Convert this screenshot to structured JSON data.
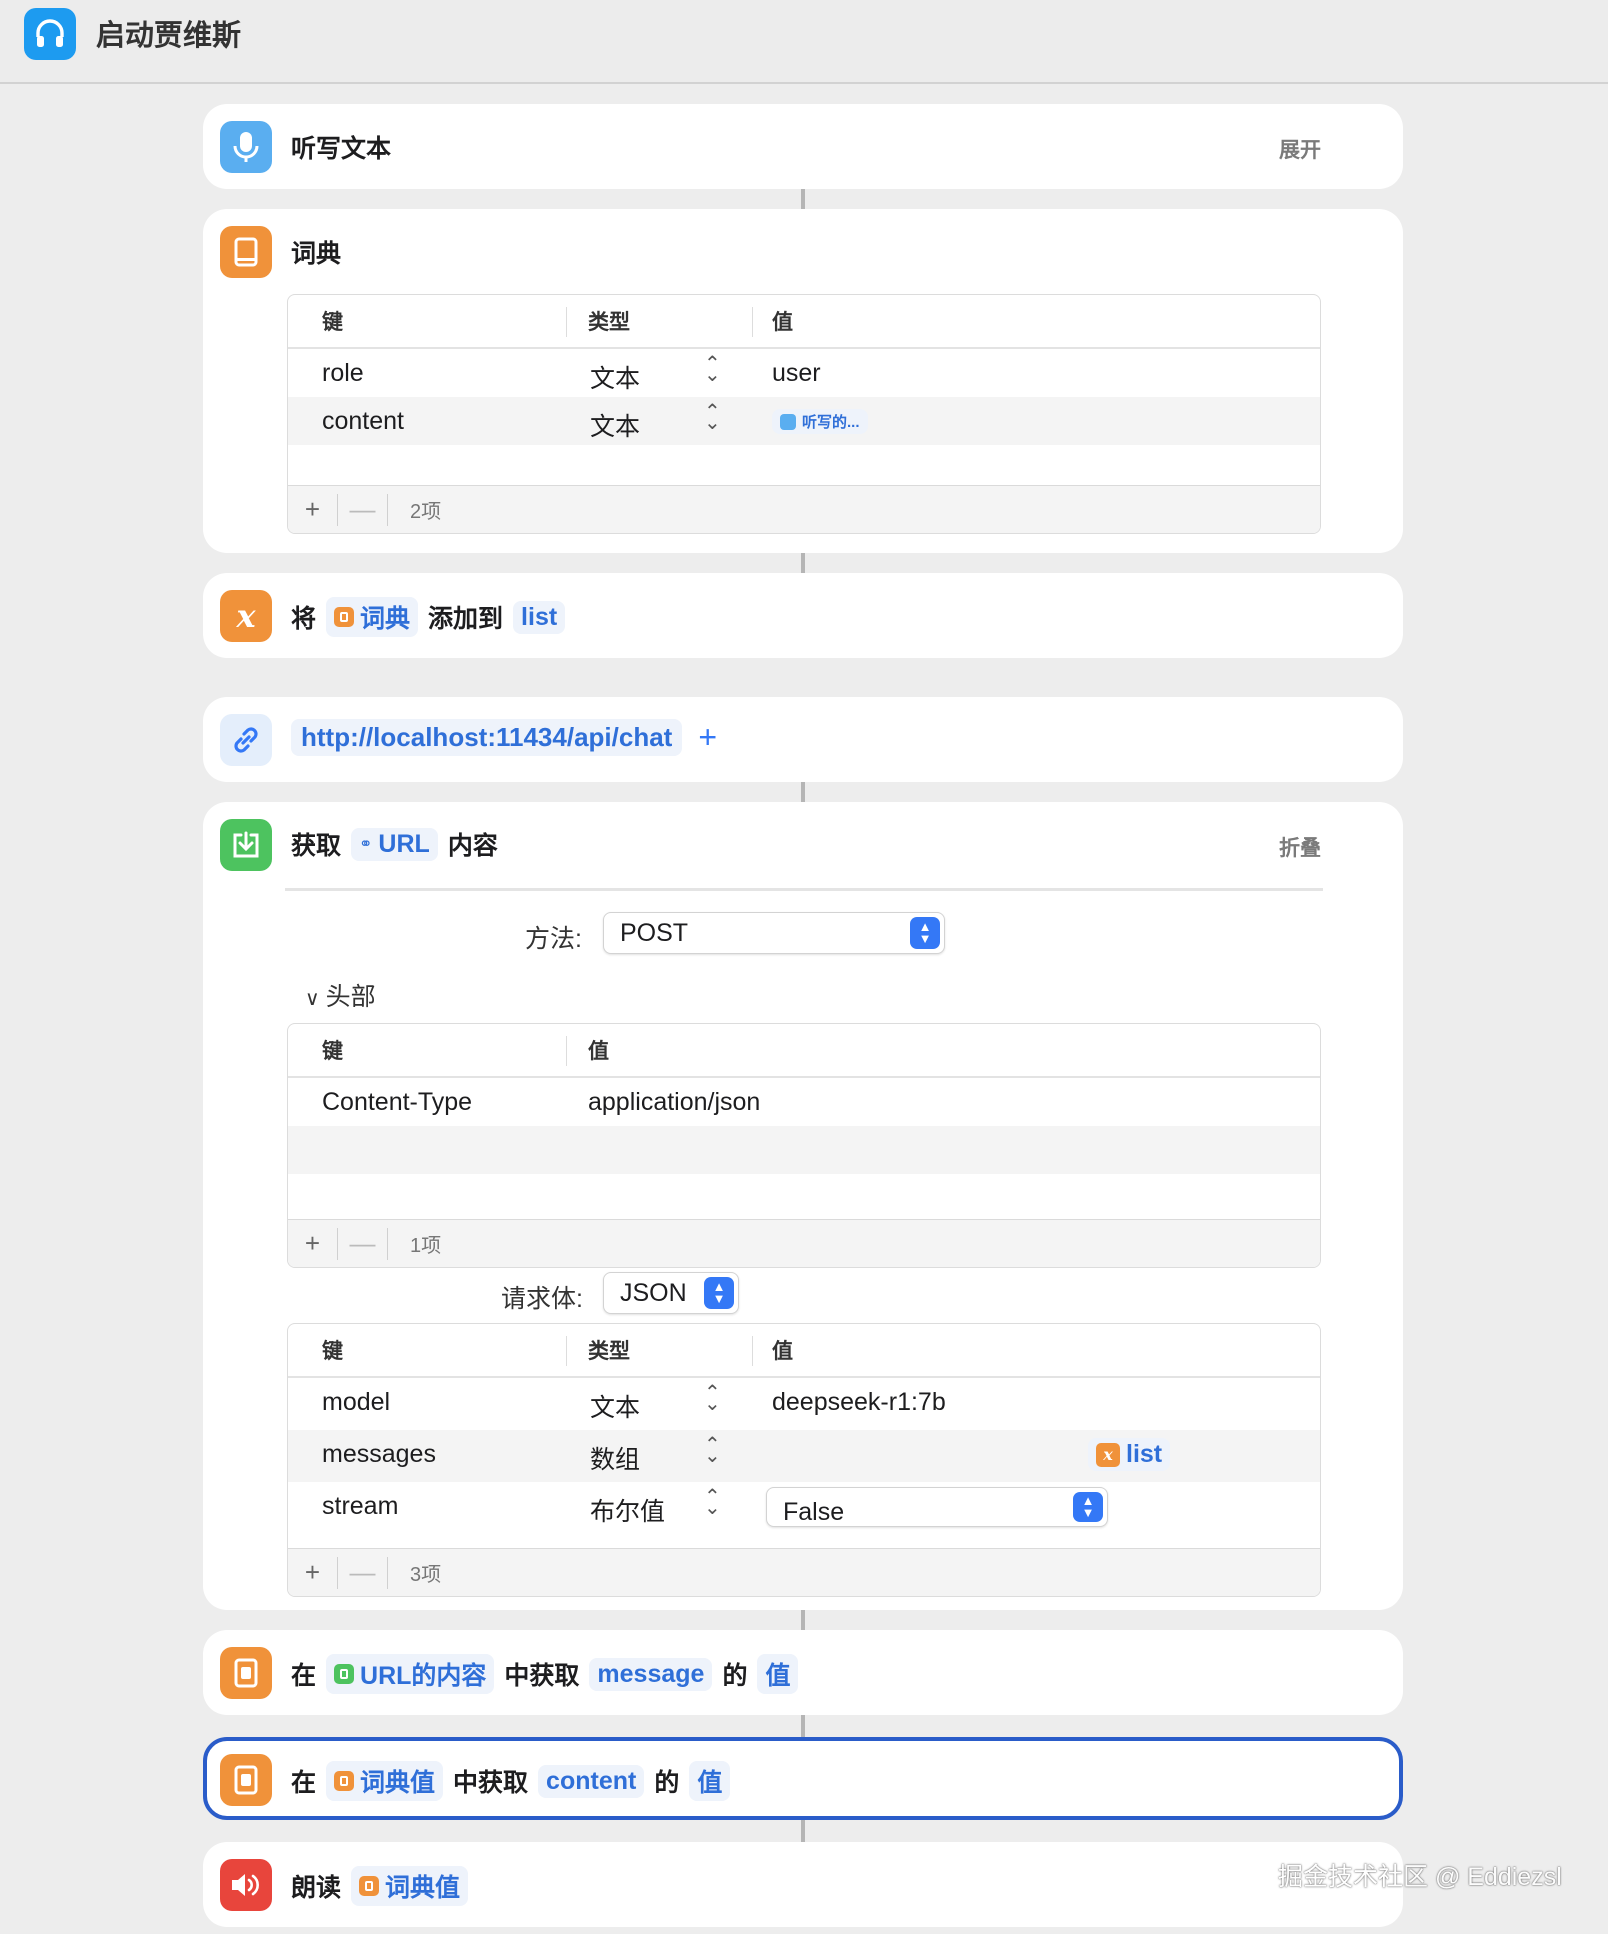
{
  "app": {
    "title": "启动贾维斯",
    "accent": "#1d9bf0"
  },
  "actions": {
    "dictate": {
      "title": "听写文本",
      "toggle": "展开"
    },
    "dictionary": {
      "title": "词典",
      "headers": {
        "key": "键",
        "type": "类型",
        "value": "值"
      },
      "rows": [
        {
          "key": "role",
          "type": "文本",
          "value": "user"
        },
        {
          "key": "content",
          "type": "文本",
          "value_token": "听写的..."
        }
      ],
      "count": "2项"
    },
    "add_to_var": {
      "prefix": "将",
      "token": "词典",
      "middle": "添加到",
      "var": "list"
    },
    "url": {
      "value": "http://localhost:11434/api/chat",
      "plus": "+"
    },
    "get_url": {
      "prefix": "获取",
      "token": "URL",
      "suffix": "内容",
      "toggle": "折叠",
      "method_label": "方法:",
      "method": "POST",
      "headers_section": "头部",
      "headers_table": {
        "key": "键",
        "value": "值",
        "rows": [
          {
            "key": "Content-Type",
            "value": "application/json"
          }
        ],
        "count": "1项"
      },
      "body_label": "请求体:",
      "body_type": "JSON",
      "body_table": {
        "key": "键",
        "type": "类型",
        "value": "值",
        "rows": [
          {
            "key": "model",
            "type": "文本",
            "value": "deepseek-r1:7b"
          },
          {
            "key": "messages",
            "type": "数组",
            "value_token": "list"
          },
          {
            "key": "stream",
            "type": "布尔值",
            "value": "False"
          }
        ],
        "count": "3项"
      }
    },
    "get_dict_value_1": {
      "prefix": "在",
      "token": "URL的内容",
      "middle": "中获取",
      "key": "message",
      "of": "的",
      "value": "值"
    },
    "get_dict_value_2": {
      "prefix": "在",
      "token": "词典值",
      "middle": "中获取",
      "key": "content",
      "of": "的",
      "value": "值"
    },
    "speak": {
      "prefix": "朗读",
      "token": "词典值"
    }
  },
  "watermark": "掘金技术社区 @ Eddiezsl",
  "icons": [
    "headphones-icon",
    "microphone-icon",
    "book-icon",
    "variable-icon",
    "link-icon",
    "download-icon",
    "speaker-icon"
  ]
}
